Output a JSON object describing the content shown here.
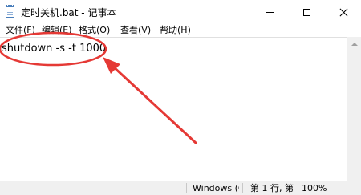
{
  "window": {
    "title": "定时关机.bat - 记事本",
    "icon": "notepad-icon",
    "buttons": {
      "minimize": "minimize-icon",
      "maximize": "maximize-icon",
      "close": "close-icon"
    }
  },
  "menu": {
    "items": [
      {
        "label": "文件(F)"
      },
      {
        "label": "编辑(E)"
      },
      {
        "label": "格式(O)"
      },
      {
        "label": "查看(V)"
      },
      {
        "label": "帮助(H)"
      }
    ]
  },
  "editor": {
    "content": "shutdown -s -t 1000"
  },
  "status": {
    "line_ending": "Windows (C",
    "position": "第 1 行, 第",
    "zoom": "100%"
  },
  "annotation": {
    "color": "#e53935"
  }
}
